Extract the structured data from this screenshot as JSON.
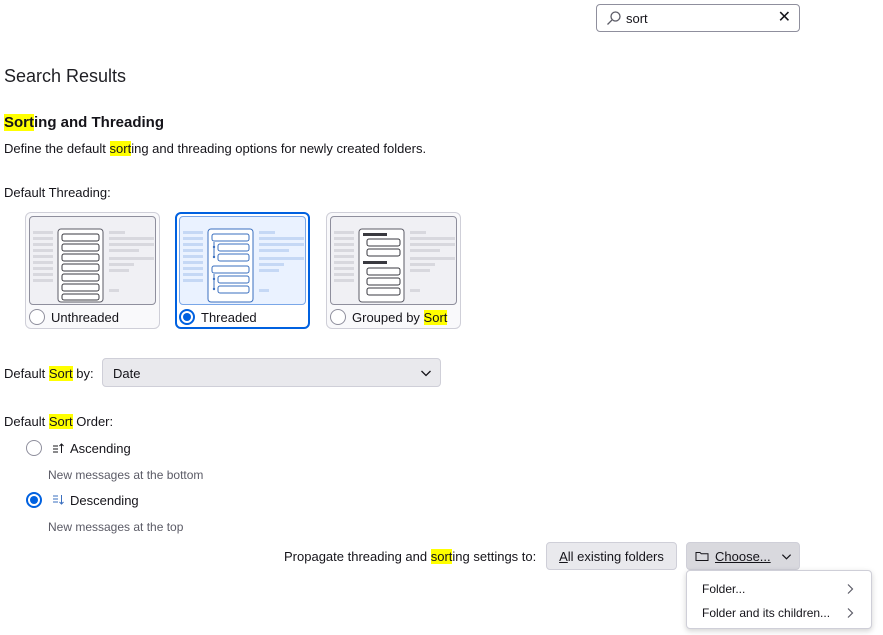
{
  "search": {
    "value": "sort",
    "icon": "search-icon",
    "clear_icon": "close-icon"
  },
  "page_title": "Search Results",
  "section": {
    "title_hl": "Sort",
    "title_rest": "ing and Threading",
    "desc_pre": "Define the default ",
    "desc_hl": "sort",
    "desc_post": "ing and threading options for newly created folders."
  },
  "threading": {
    "label": "Default Threading:",
    "options": [
      {
        "label": "Unthreaded",
        "selected": false
      },
      {
        "label": "Threaded",
        "selected": true
      },
      {
        "label_pre": "Grouped by ",
        "label_hl": "Sort",
        "selected": false
      }
    ]
  },
  "sort_by": {
    "label_pre": "Default ",
    "label_hl": "Sort",
    "label_post": " by:",
    "value": "Date"
  },
  "sort_order": {
    "label_pre": "Default ",
    "label_hl": "Sort",
    "label_post": " Order:",
    "ascending": {
      "label": "Ascending",
      "hint": "New messages at the bottom",
      "selected": false
    },
    "descending": {
      "label": "Descending",
      "hint": "New messages at the top",
      "selected": true
    }
  },
  "propagate": {
    "label_pre": "Propagate threading and ",
    "label_hl": "sort",
    "label_post": "ing settings to:",
    "all_folders_accesskey": "A",
    "all_folders_rest": "ll existing folders",
    "choose_label": "Choose..."
  },
  "choose_menu": {
    "items": [
      {
        "label": "Folder..."
      },
      {
        "label": "Folder and its children..."
      }
    ]
  },
  "colors": {
    "accent": "#0061e0",
    "highlight": "#ffff00"
  }
}
